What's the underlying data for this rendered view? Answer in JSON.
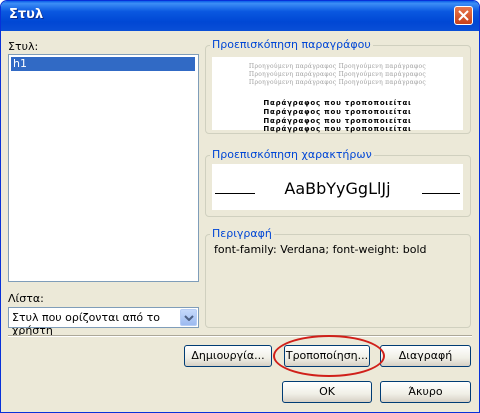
{
  "window": {
    "title": "Στυλ"
  },
  "styles": {
    "label": "Στυλ:",
    "items": [
      "h1"
    ]
  },
  "list_filter": {
    "label": "Λίστα:",
    "selected": "Στυλ που ορίζονται από το χρήστη"
  },
  "paragraph_preview": {
    "title": "Προεπισκόπηση παραγράφου",
    "prev_line": "Προηγούμενη παράγραφος Προηγούμενη παράγραφος",
    "sample_line": "Παράγραφος που τροποποιείται"
  },
  "char_preview": {
    "title": "Προεπισκόπηση χαρακτήρων",
    "sample": "AaBbYyGgLlJj"
  },
  "description": {
    "title": "Περιγραφή",
    "text": "font-family: Verdana; font-weight: bold"
  },
  "buttons": {
    "new": "Δημιουργία...",
    "modify": "Τροποποίηση...",
    "delete": "Διαγραφή",
    "ok": "OK",
    "cancel": "Άκυρο"
  },
  "colors": {
    "titlebar": "#0a58e0",
    "selection": "#316ac5",
    "group_title": "#0046d5",
    "highlight_oval": "#d0201a"
  }
}
